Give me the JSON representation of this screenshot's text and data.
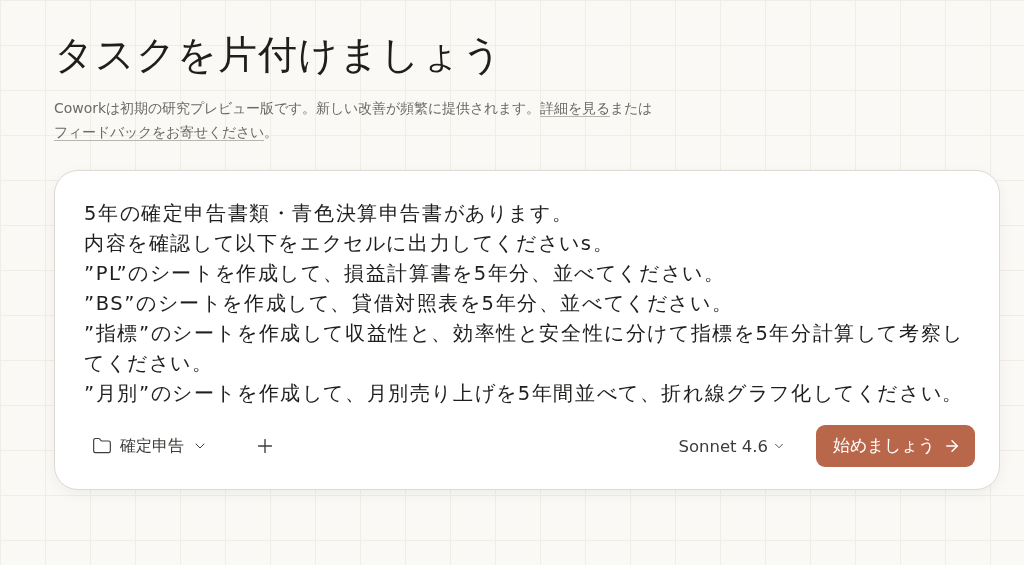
{
  "title": "タスクを片付けましょう",
  "notice": {
    "before": "Coworkは初期の研究プレビュー版です。新しい改善が頻繁に提供されます。",
    "details_link": "詳細を見る",
    "middle": "または",
    "feedback_link": "フィードバックをお寄せください",
    "after": "。"
  },
  "prompt": {
    "lines": [
      "5年の確定申告書類・青色決算申告書があります。",
      "内容を確認して以下をエクセルに出力してくださいs。",
      "”PL”のシートを作成して、損益計算書を5年分、並べてください。",
      "”BS”のシートを作成して、貸借対照表を5年分、並べてください。",
      "”指標”のシートを作成して収益性と、効率性と安全性に分けて指標を5年分計算して考察してください。",
      "”月別”のシートを作成して、月別売り上げを5年間並べて、折れ線グラフ化してください。"
    ]
  },
  "folder": {
    "label": "確定申告"
  },
  "model": {
    "label": "Sonnet 4.6"
  },
  "start_button": {
    "label": "始めましょう"
  }
}
